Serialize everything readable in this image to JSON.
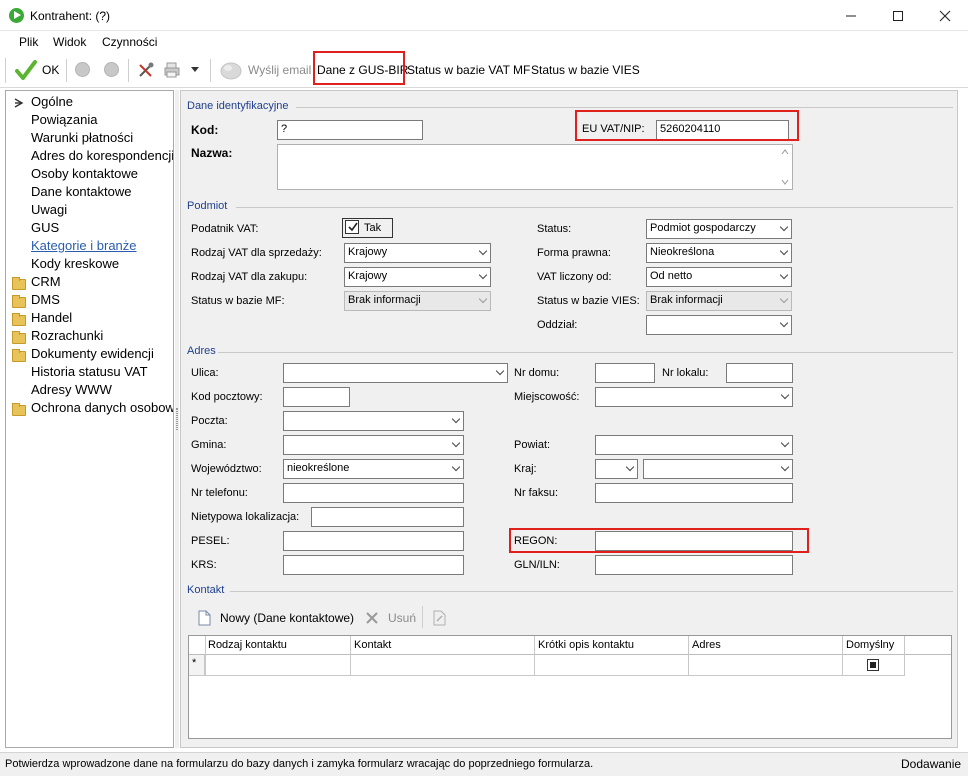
{
  "window": {
    "title": "Kontrahent:  (?)"
  },
  "menu": [
    "Plik",
    "Widok",
    "Czynności"
  ],
  "toolbar": {
    "ok": "OK",
    "send_email": "Wyślij email",
    "gus_bir": "Dane z GUS-BIR",
    "vat_mf": "Status w bazie VAT MF",
    "vies": "Status w bazie VIES"
  },
  "sidebar": {
    "items": [
      {
        "label": "Ogólne",
        "type": "leaf",
        "active": true
      },
      {
        "label": "Powiązania",
        "type": "leaf"
      },
      {
        "label": "Warunki płatności",
        "type": "leaf"
      },
      {
        "label": "Adres do korespondencji",
        "type": "leaf"
      },
      {
        "label": "Osoby kontaktowe",
        "type": "leaf"
      },
      {
        "label": "Dane kontaktowe",
        "type": "leaf"
      },
      {
        "label": "Uwagi",
        "type": "leaf"
      },
      {
        "label": "GUS",
        "type": "leaf"
      },
      {
        "label": "Kategorie i branże",
        "type": "link"
      },
      {
        "label": "Kody kreskowe",
        "type": "leaf"
      },
      {
        "label": "CRM",
        "type": "folder"
      },
      {
        "label": "DMS",
        "type": "folder"
      },
      {
        "label": "Handel",
        "type": "folder"
      },
      {
        "label": "Rozrachunki",
        "type": "folder"
      },
      {
        "label": "Dokumenty ewidencji",
        "type": "folder"
      },
      {
        "label": "Historia statusu VAT",
        "type": "leaf"
      },
      {
        "label": "Adresy WWW",
        "type": "leaf"
      },
      {
        "label": "Ochrona danych osobowych",
        "type": "folder"
      }
    ]
  },
  "ident": {
    "section": "Dane identyfikacyjne",
    "kod_label": "Kod:",
    "kod_value": "?",
    "nazwa_label": "Nazwa:",
    "euvat_label": "EU VAT/NIP:",
    "euvat_value": "5260204110"
  },
  "podmiot": {
    "section": "Podmiot",
    "vat_payer_label": "Podatnik VAT:",
    "vat_payer_check": "Tak",
    "vat_sale_label": "Rodzaj VAT dla sprzedaży:",
    "vat_sale_value": "Krajowy",
    "vat_buy_label": "Rodzaj VAT dla zakupu:",
    "vat_buy_value": "Krajowy",
    "status_mf_label": "Status w bazie MF:",
    "status_mf_value": "Brak informacji",
    "status_label": "Status:",
    "status_value": "Podmiot gospodarczy",
    "legal_label": "Forma prawna:",
    "legal_value": "Nieokreślona",
    "vat_calc_label": "VAT liczony od:",
    "vat_calc_value": "Od netto",
    "status_vies_label": "Status w bazie VIES:",
    "status_vies_value": "Brak informacji",
    "branch_label": "Oddział:"
  },
  "address": {
    "section": "Adres",
    "street": "Ulica:",
    "house_no": "Nr domu:",
    "flat_no": "Nr lokalu:",
    "postal": "Kod pocztowy:",
    "city": "Miejscowość:",
    "post": "Poczta:",
    "commune": "Gmina:",
    "county": "Powiat:",
    "voivodeship": "Województwo:",
    "voivodeship_value": "nieokreślone",
    "country": "Kraj:",
    "phone": "Nr telefonu:",
    "fax": "Nr faksu:",
    "nonstandard": "Nietypowa lokalizacja:",
    "pesel": "PESEL:",
    "regon": "REGON:",
    "krs": "KRS:",
    "gln": "GLN/ILN:"
  },
  "contact": {
    "section": "Kontakt",
    "new_btn": "Nowy (Dane kontaktowe)",
    "delete_btn": "Usuń",
    "columns": [
      "Rodzaj kontaktu",
      "Kontakt",
      "Krótki opis kontaktu",
      "Adres",
      "Domyślny"
    ]
  },
  "statusbar": {
    "message": "Potwierdza wprowadzone dane na formularzu do bazy danych i zamyka formularz wracając do poprzedniego formularza.",
    "mode": "Dodawanie"
  }
}
